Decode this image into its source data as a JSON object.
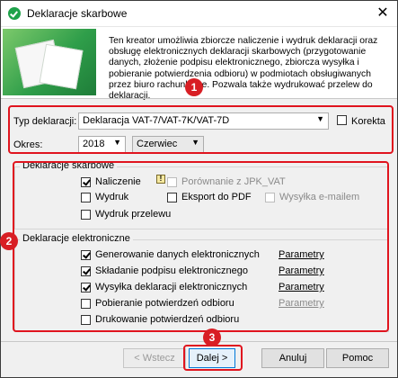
{
  "window": {
    "title": "Deklaracje skarbowe",
    "close": "✕"
  },
  "banner": {
    "text": "Ten kreator umożliwia zbiorcze naliczenie i wydruk deklaracji oraz obsługę elektronicznych deklaracji skarbowych (przygotowanie danych, złożenie podpisu elektronicznego, zbiorcza wysyłka i pobieranie potwierdzenia odbioru) w podmiotach obsługiwanych przez biuro rachunkowe. Pozwala także wydrukować przelew do deklaracji."
  },
  "form": {
    "typ_label": "Typ deklaracji:",
    "typ_value": "Deklaracja VAT-7/VAT-7K/VAT-7D",
    "korekta_label": "Korekta",
    "okres_label": "Okres:",
    "year_value": "2018",
    "month_value": "Czerwiec"
  },
  "skarbowe": {
    "title": "Deklaracje skarbowe",
    "naliczenie": "Naliczenie",
    "porownanie": "Porównanie z JPK_VAT",
    "wydruk": "Wydruk",
    "eksport": "Eksport do PDF",
    "wysylka_email": "Wysyłka e-mailem",
    "wydruk_przelewu": "Wydruk przelewu",
    "info_icon": "!"
  },
  "elektroniczne": {
    "title": "Deklaracje elektroniczne",
    "items": [
      {
        "label": "Generowanie danych elektronicznych",
        "param": "Parametry"
      },
      {
        "label": "Składanie podpisu elektronicznego",
        "param": "Parametry"
      },
      {
        "label": "Wysyłka deklaracji elektronicznych",
        "param": "Parametry"
      },
      {
        "label": "Pobieranie potwierdzeń odbioru",
        "param": "Parametry"
      },
      {
        "label": "Drukowanie potwierdzeń odbioru"
      }
    ]
  },
  "badges": [
    "1",
    "2",
    "3"
  ],
  "buttons": {
    "back": "< Wstecz",
    "next": "Dalej >",
    "cancel": "Anuluj",
    "help": "Pomoc"
  },
  "colors": {
    "accent_red": "#e0141e",
    "brand_green": "#1fa24a"
  }
}
